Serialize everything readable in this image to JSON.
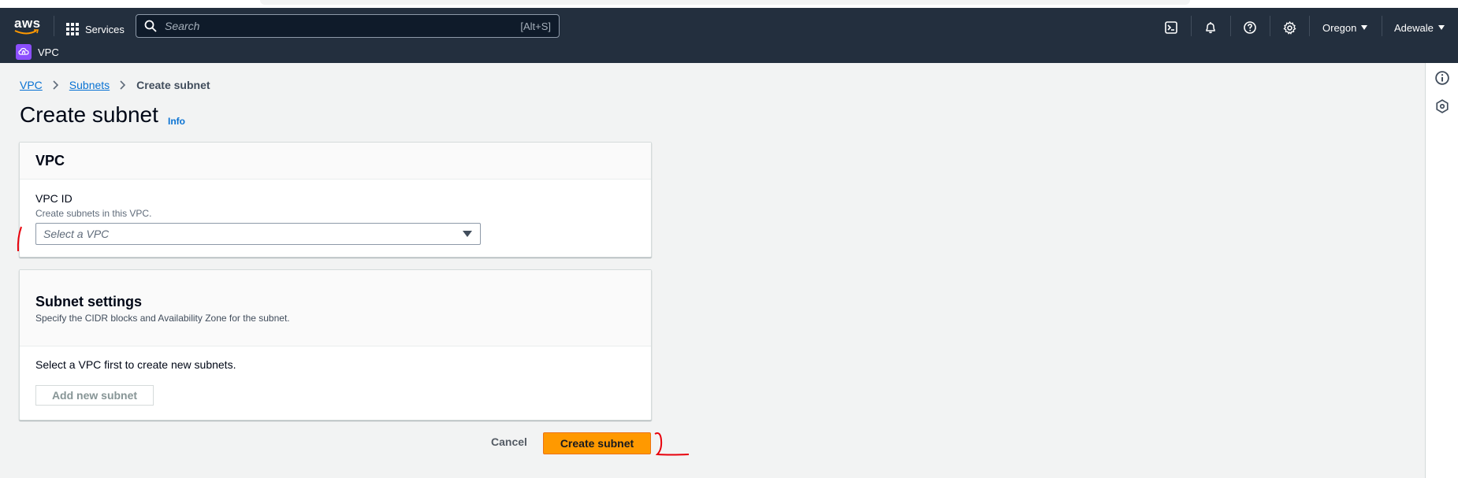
{
  "navbar": {
    "logo_text": "aws",
    "services_label": "Services",
    "search_placeholder": "Search",
    "search_shortcut": "[Alt+S]",
    "region_label": "Oregon",
    "user_label": "Adewale",
    "service_badge": "VPC",
    "background_color": "#232f3e"
  },
  "breadcrumb": {
    "items": [
      "VPC",
      "Subnets"
    ],
    "current": "Create subnet"
  },
  "page": {
    "title": "Create subnet",
    "info_link": "Info"
  },
  "vpc_panel": {
    "heading": "VPC",
    "field_label": "VPC ID",
    "field_description": "Create subnets in this VPC.",
    "select_placeholder": "Select a VPC"
  },
  "subnet_panel": {
    "heading": "Subnet settings",
    "description": "Specify the CIDR blocks and Availability Zone for the subnet.",
    "note": "Select a VPC first to create new subnets.",
    "add_button": "Add new subnet"
  },
  "actions": {
    "cancel_label": "Cancel",
    "create_label": "Create subnet",
    "primary_color": "#ff9900"
  },
  "icons": {
    "navbar": [
      "cloudshell-icon",
      "bell-icon",
      "help-icon",
      "settings-icon"
    ],
    "rail": [
      "info-icon",
      "feedback-icon"
    ]
  }
}
